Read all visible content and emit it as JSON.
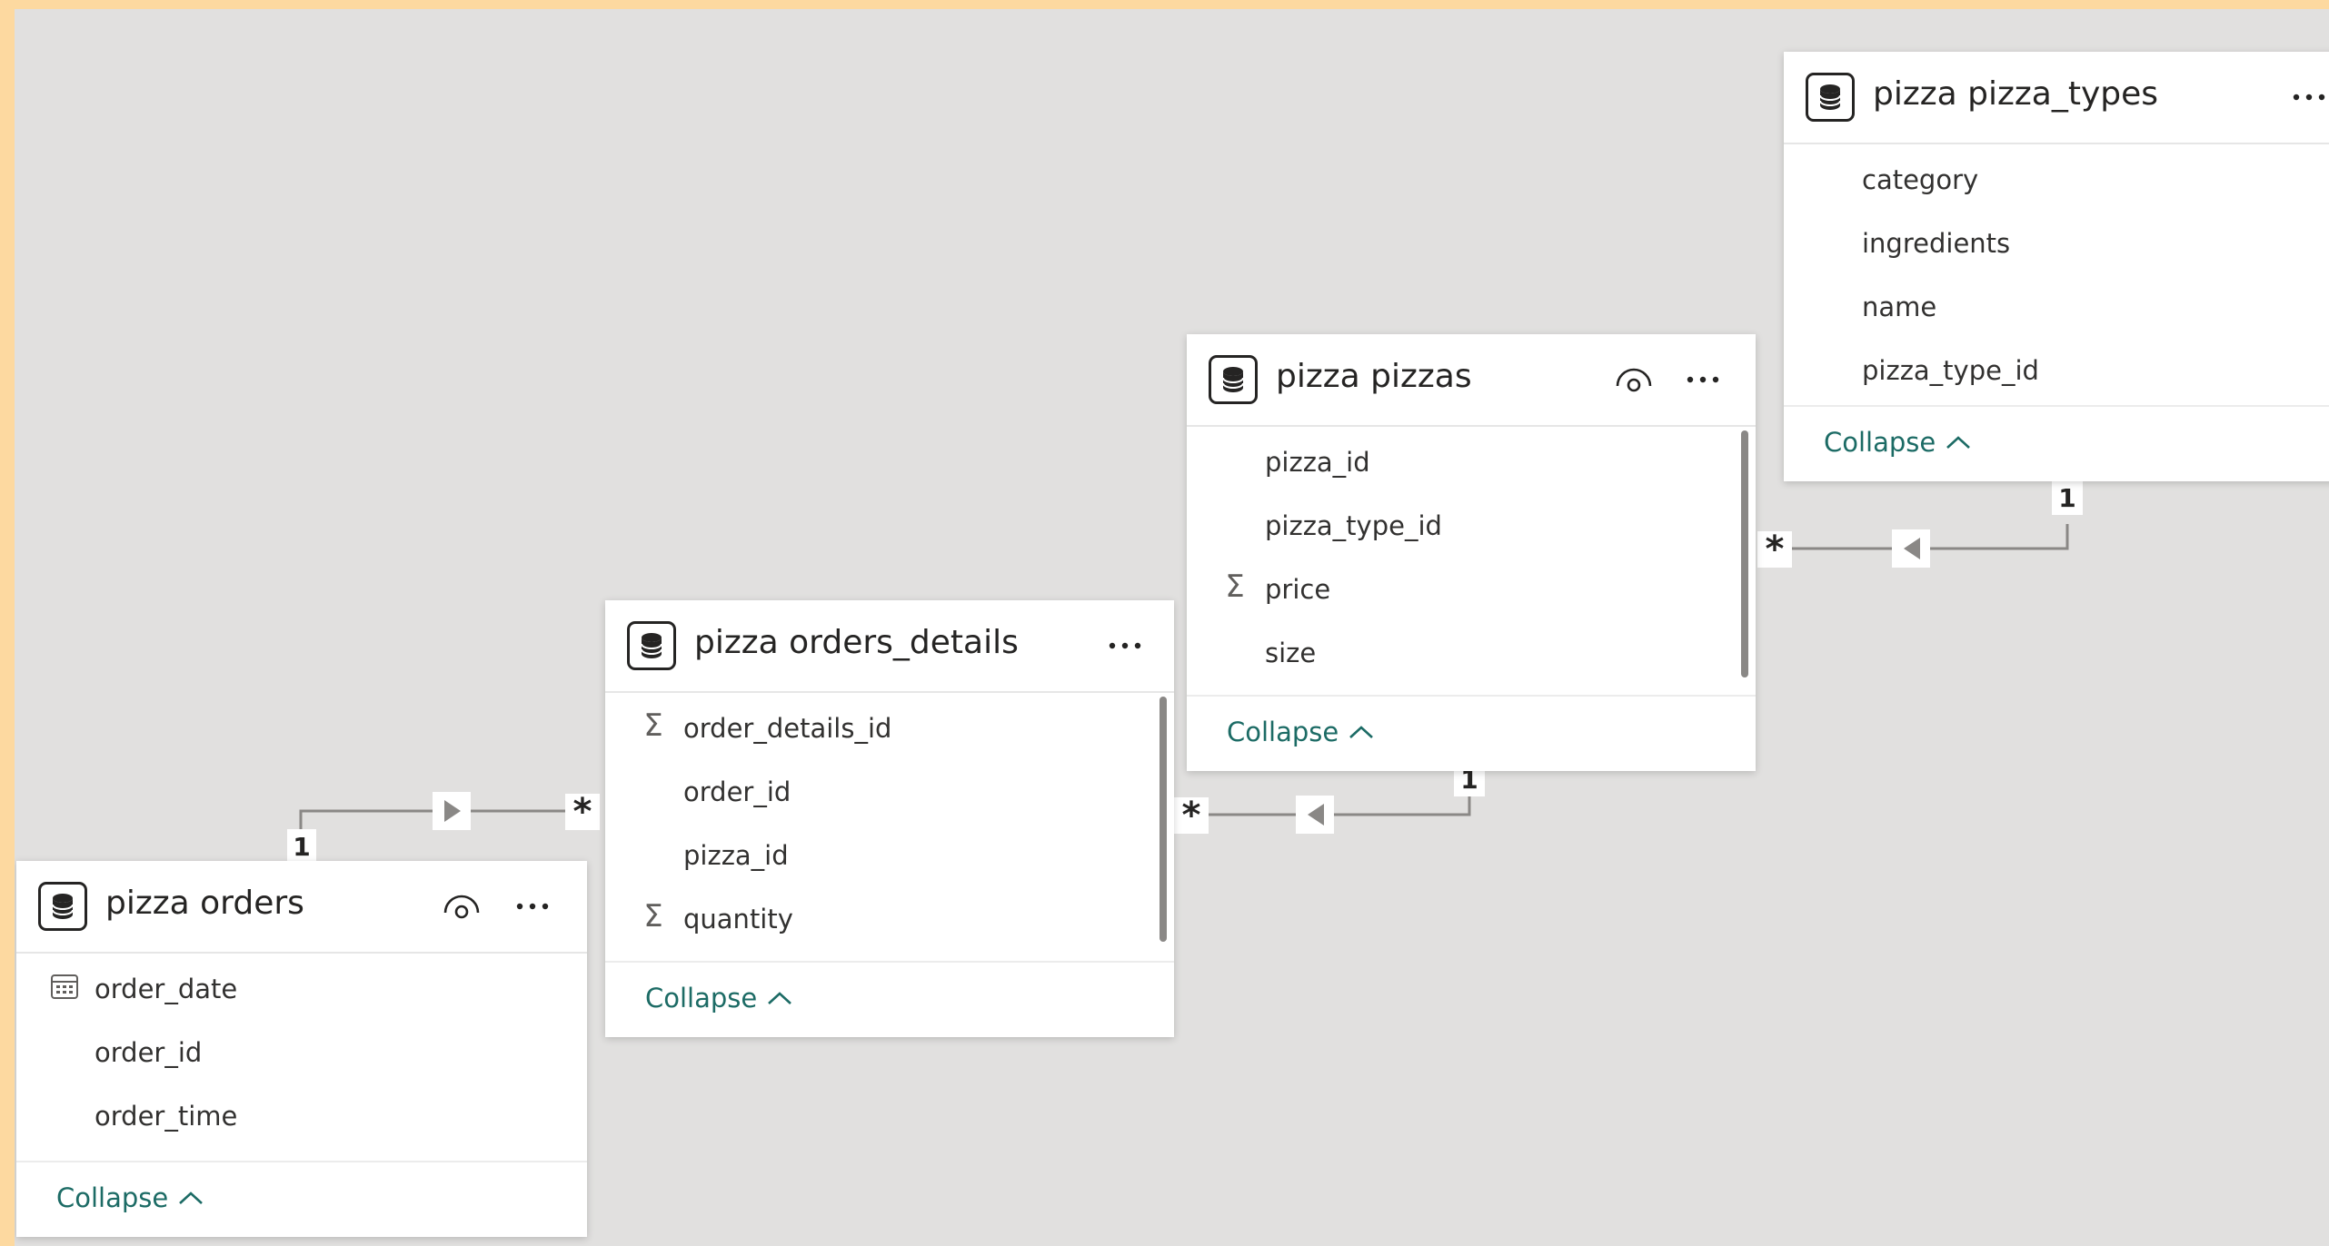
{
  "tables": {
    "orders": {
      "title": "pizza orders",
      "fields": [
        "order_date",
        "order_id",
        "order_time"
      ],
      "collapse_label": "Collapse"
    },
    "orders_details": {
      "title": "pizza orders_details",
      "fields": [
        "order_details_id",
        "order_id",
        "pizza_id",
        "quantity"
      ],
      "collapse_label": "Collapse"
    },
    "pizzas": {
      "title": "pizza pizzas",
      "fields": [
        "pizza_id",
        "pizza_type_id",
        "price",
        "size"
      ],
      "collapse_label": "Collapse"
    },
    "pizza_types": {
      "title": "pizza pizza_types",
      "fields": [
        "category",
        "ingredients",
        "name",
        "pizza_type_id"
      ],
      "collapse_label": "Collapse"
    }
  },
  "relationships": [
    {
      "from": "pizza orders",
      "to": "pizza orders_details",
      "one_label": "1",
      "many_label": "*"
    },
    {
      "from": "pizza pizzas",
      "to": "pizza orders_details",
      "one_label": "1",
      "many_label": "*"
    },
    {
      "from": "pizza pizza_types",
      "to": "pizza pizzas",
      "one_label": "1",
      "many_label": "*"
    }
  ],
  "icons": {
    "table": "database-icon",
    "visibility": "eye-icon",
    "more": "more-options-icon",
    "sum": "sigma-icon",
    "date": "calendar-icon",
    "collapse": "chevron-up-icon"
  },
  "colors": {
    "canvas": "#e1e0df",
    "frame": "#fdd9a0",
    "link": "#1c6b65",
    "line": "#8a8886"
  }
}
